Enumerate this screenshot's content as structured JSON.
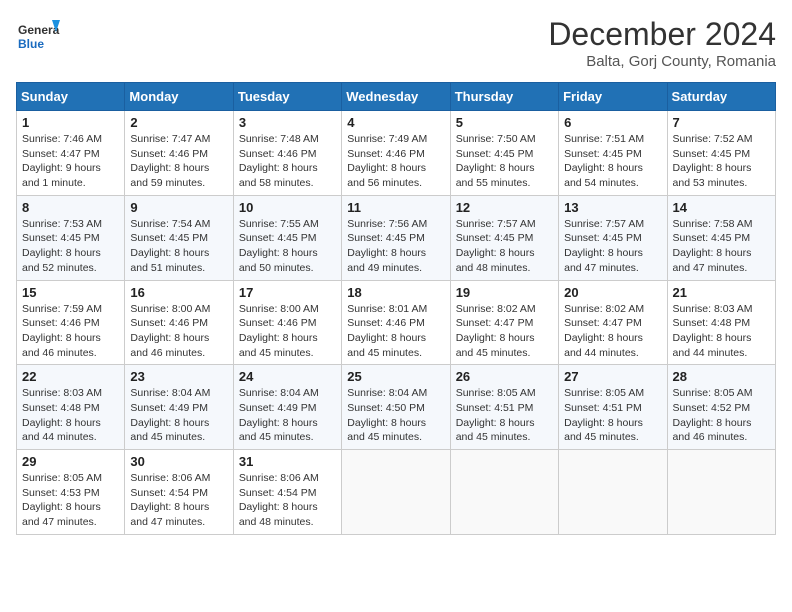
{
  "logo": {
    "general": "General",
    "blue": "Blue"
  },
  "title": "December 2024",
  "location": "Balta, Gorj County, Romania",
  "days_of_week": [
    "Sunday",
    "Monday",
    "Tuesday",
    "Wednesday",
    "Thursday",
    "Friday",
    "Saturday"
  ],
  "weeks": [
    [
      {
        "day": "1",
        "sunrise": "Sunrise: 7:46 AM",
        "sunset": "Sunset: 4:47 PM",
        "daylight": "Daylight: 9 hours and 1 minute."
      },
      {
        "day": "2",
        "sunrise": "Sunrise: 7:47 AM",
        "sunset": "Sunset: 4:46 PM",
        "daylight": "Daylight: 8 hours and 59 minutes."
      },
      {
        "day": "3",
        "sunrise": "Sunrise: 7:48 AM",
        "sunset": "Sunset: 4:46 PM",
        "daylight": "Daylight: 8 hours and 58 minutes."
      },
      {
        "day": "4",
        "sunrise": "Sunrise: 7:49 AM",
        "sunset": "Sunset: 4:46 PM",
        "daylight": "Daylight: 8 hours and 56 minutes."
      },
      {
        "day": "5",
        "sunrise": "Sunrise: 7:50 AM",
        "sunset": "Sunset: 4:45 PM",
        "daylight": "Daylight: 8 hours and 55 minutes."
      },
      {
        "day": "6",
        "sunrise": "Sunrise: 7:51 AM",
        "sunset": "Sunset: 4:45 PM",
        "daylight": "Daylight: 8 hours and 54 minutes."
      },
      {
        "day": "7",
        "sunrise": "Sunrise: 7:52 AM",
        "sunset": "Sunset: 4:45 PM",
        "daylight": "Daylight: 8 hours and 53 minutes."
      }
    ],
    [
      {
        "day": "8",
        "sunrise": "Sunrise: 7:53 AM",
        "sunset": "Sunset: 4:45 PM",
        "daylight": "Daylight: 8 hours and 52 minutes."
      },
      {
        "day": "9",
        "sunrise": "Sunrise: 7:54 AM",
        "sunset": "Sunset: 4:45 PM",
        "daylight": "Daylight: 8 hours and 51 minutes."
      },
      {
        "day": "10",
        "sunrise": "Sunrise: 7:55 AM",
        "sunset": "Sunset: 4:45 PM",
        "daylight": "Daylight: 8 hours and 50 minutes."
      },
      {
        "day": "11",
        "sunrise": "Sunrise: 7:56 AM",
        "sunset": "Sunset: 4:45 PM",
        "daylight": "Daylight: 8 hours and 49 minutes."
      },
      {
        "day": "12",
        "sunrise": "Sunrise: 7:57 AM",
        "sunset": "Sunset: 4:45 PM",
        "daylight": "Daylight: 8 hours and 48 minutes."
      },
      {
        "day": "13",
        "sunrise": "Sunrise: 7:57 AM",
        "sunset": "Sunset: 4:45 PM",
        "daylight": "Daylight: 8 hours and 47 minutes."
      },
      {
        "day": "14",
        "sunrise": "Sunrise: 7:58 AM",
        "sunset": "Sunset: 4:45 PM",
        "daylight": "Daylight: 8 hours and 47 minutes."
      }
    ],
    [
      {
        "day": "15",
        "sunrise": "Sunrise: 7:59 AM",
        "sunset": "Sunset: 4:46 PM",
        "daylight": "Daylight: 8 hours and 46 minutes."
      },
      {
        "day": "16",
        "sunrise": "Sunrise: 8:00 AM",
        "sunset": "Sunset: 4:46 PM",
        "daylight": "Daylight: 8 hours and 46 minutes."
      },
      {
        "day": "17",
        "sunrise": "Sunrise: 8:00 AM",
        "sunset": "Sunset: 4:46 PM",
        "daylight": "Daylight: 8 hours and 45 minutes."
      },
      {
        "day": "18",
        "sunrise": "Sunrise: 8:01 AM",
        "sunset": "Sunset: 4:46 PM",
        "daylight": "Daylight: 8 hours and 45 minutes."
      },
      {
        "day": "19",
        "sunrise": "Sunrise: 8:02 AM",
        "sunset": "Sunset: 4:47 PM",
        "daylight": "Daylight: 8 hours and 45 minutes."
      },
      {
        "day": "20",
        "sunrise": "Sunrise: 8:02 AM",
        "sunset": "Sunset: 4:47 PM",
        "daylight": "Daylight: 8 hours and 44 minutes."
      },
      {
        "day": "21",
        "sunrise": "Sunrise: 8:03 AM",
        "sunset": "Sunset: 4:48 PM",
        "daylight": "Daylight: 8 hours and 44 minutes."
      }
    ],
    [
      {
        "day": "22",
        "sunrise": "Sunrise: 8:03 AM",
        "sunset": "Sunset: 4:48 PM",
        "daylight": "Daylight: 8 hours and 44 minutes."
      },
      {
        "day": "23",
        "sunrise": "Sunrise: 8:04 AM",
        "sunset": "Sunset: 4:49 PM",
        "daylight": "Daylight: 8 hours and 45 minutes."
      },
      {
        "day": "24",
        "sunrise": "Sunrise: 8:04 AM",
        "sunset": "Sunset: 4:49 PM",
        "daylight": "Daylight: 8 hours and 45 minutes."
      },
      {
        "day": "25",
        "sunrise": "Sunrise: 8:04 AM",
        "sunset": "Sunset: 4:50 PM",
        "daylight": "Daylight: 8 hours and 45 minutes."
      },
      {
        "day": "26",
        "sunrise": "Sunrise: 8:05 AM",
        "sunset": "Sunset: 4:51 PM",
        "daylight": "Daylight: 8 hours and 45 minutes."
      },
      {
        "day": "27",
        "sunrise": "Sunrise: 8:05 AM",
        "sunset": "Sunset: 4:51 PM",
        "daylight": "Daylight: 8 hours and 45 minutes."
      },
      {
        "day": "28",
        "sunrise": "Sunrise: 8:05 AM",
        "sunset": "Sunset: 4:52 PM",
        "daylight": "Daylight: 8 hours and 46 minutes."
      }
    ],
    [
      {
        "day": "29",
        "sunrise": "Sunrise: 8:05 AM",
        "sunset": "Sunset: 4:53 PM",
        "daylight": "Daylight: 8 hours and 47 minutes."
      },
      {
        "day": "30",
        "sunrise": "Sunrise: 8:06 AM",
        "sunset": "Sunset: 4:54 PM",
        "daylight": "Daylight: 8 hours and 47 minutes."
      },
      {
        "day": "31",
        "sunrise": "Sunrise: 8:06 AM",
        "sunset": "Sunset: 4:54 PM",
        "daylight": "Daylight: 8 hours and 48 minutes."
      },
      null,
      null,
      null,
      null
    ]
  ]
}
